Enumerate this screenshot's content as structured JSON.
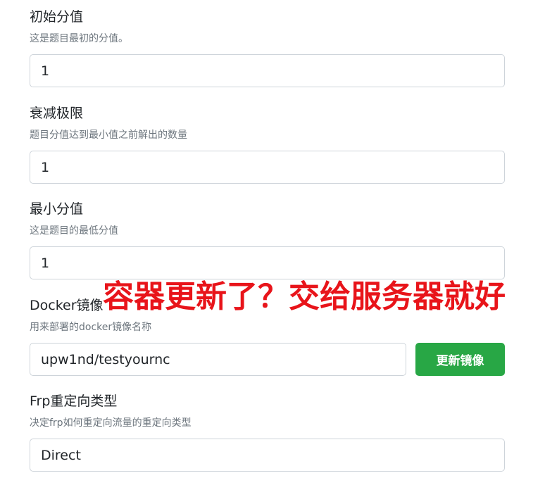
{
  "fields": [
    {
      "label": "初始分值",
      "help": "这是题目最初的分值。",
      "value": "1"
    },
    {
      "label": "衰减极限",
      "help": "题目分值达到最小值之前解出的数量",
      "value": "1"
    },
    {
      "label": "最小分值",
      "help": "这是题目的最低分值",
      "value": "1"
    },
    {
      "label": "Docker镜像",
      "help": "用来部署的docker镜像名称",
      "value": "upw1nd/testyournc",
      "button_label": "更新镜像"
    },
    {
      "label": "Frp重定向类型",
      "help": "决定frp如何重定向流量的重定向类型",
      "value": "Direct"
    }
  ],
  "overlay_caption": "容器更新了？交给服务器就好",
  "colors": {
    "button_green": "#28a745",
    "caption_red": "#e8141a"
  }
}
